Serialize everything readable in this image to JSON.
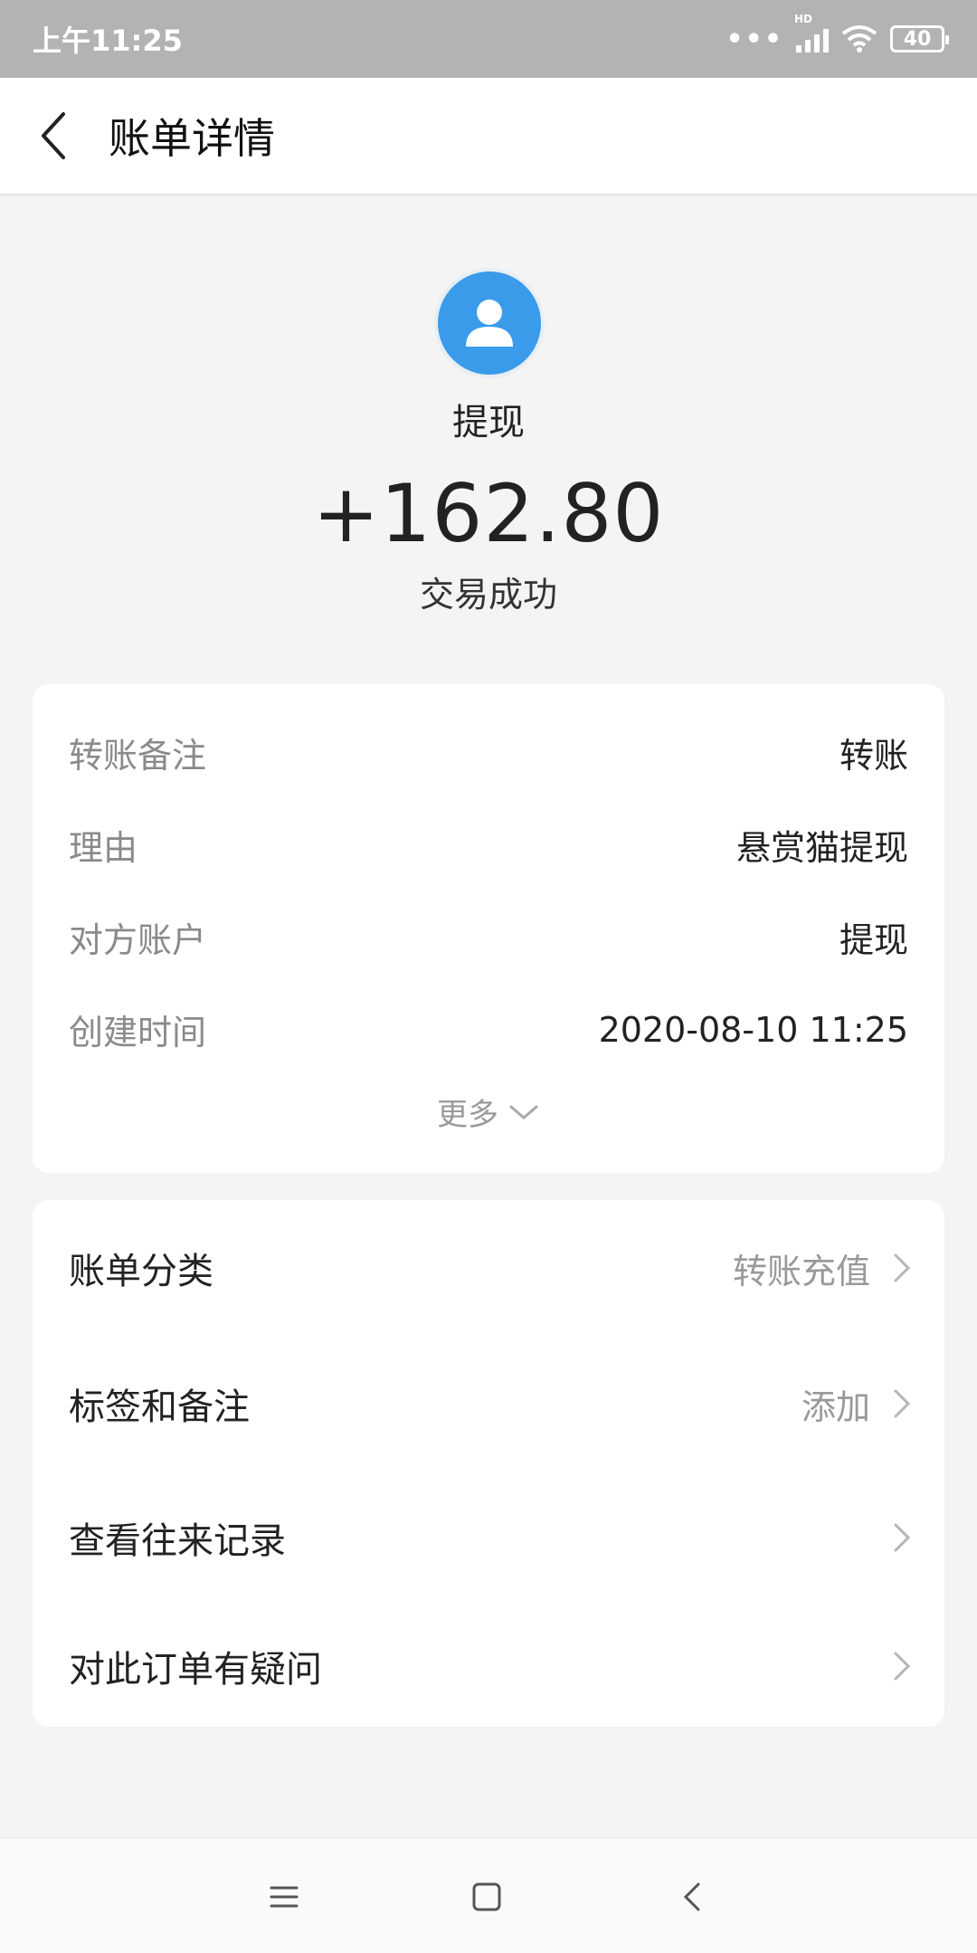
{
  "status_bar": {
    "time": "上午11:25",
    "dots": "•••",
    "network": "HD",
    "battery": "40"
  },
  "header": {
    "title": "账单详情"
  },
  "summary": {
    "payee": "提现",
    "amount": "+162.80",
    "status": "交易成功"
  },
  "details": [
    {
      "label": "转账备注",
      "value": "转账"
    },
    {
      "label": "理由",
      "value": "悬赏猫提现"
    },
    {
      "label": "对方账户",
      "value": "提现"
    },
    {
      "label": "创建时间",
      "value": "2020-08-10 11:25"
    }
  ],
  "more_label": "更多",
  "actions": [
    {
      "label": "账单分类",
      "value": "转账充值"
    },
    {
      "label": "标签和备注",
      "value": "添加"
    },
    {
      "label": "查看往来记录",
      "value": ""
    },
    {
      "label": "对此订单有疑问",
      "value": ""
    }
  ],
  "colors": {
    "accent": "#3a9bea",
    "status_bar": "#b3b3b3",
    "background": "#f4f4f4"
  },
  "icons": [
    "chevron-left-icon",
    "avatar-icon",
    "chevron-down-icon",
    "chevron-right-icon",
    "menu-icon",
    "home-icon",
    "back-icon"
  ]
}
